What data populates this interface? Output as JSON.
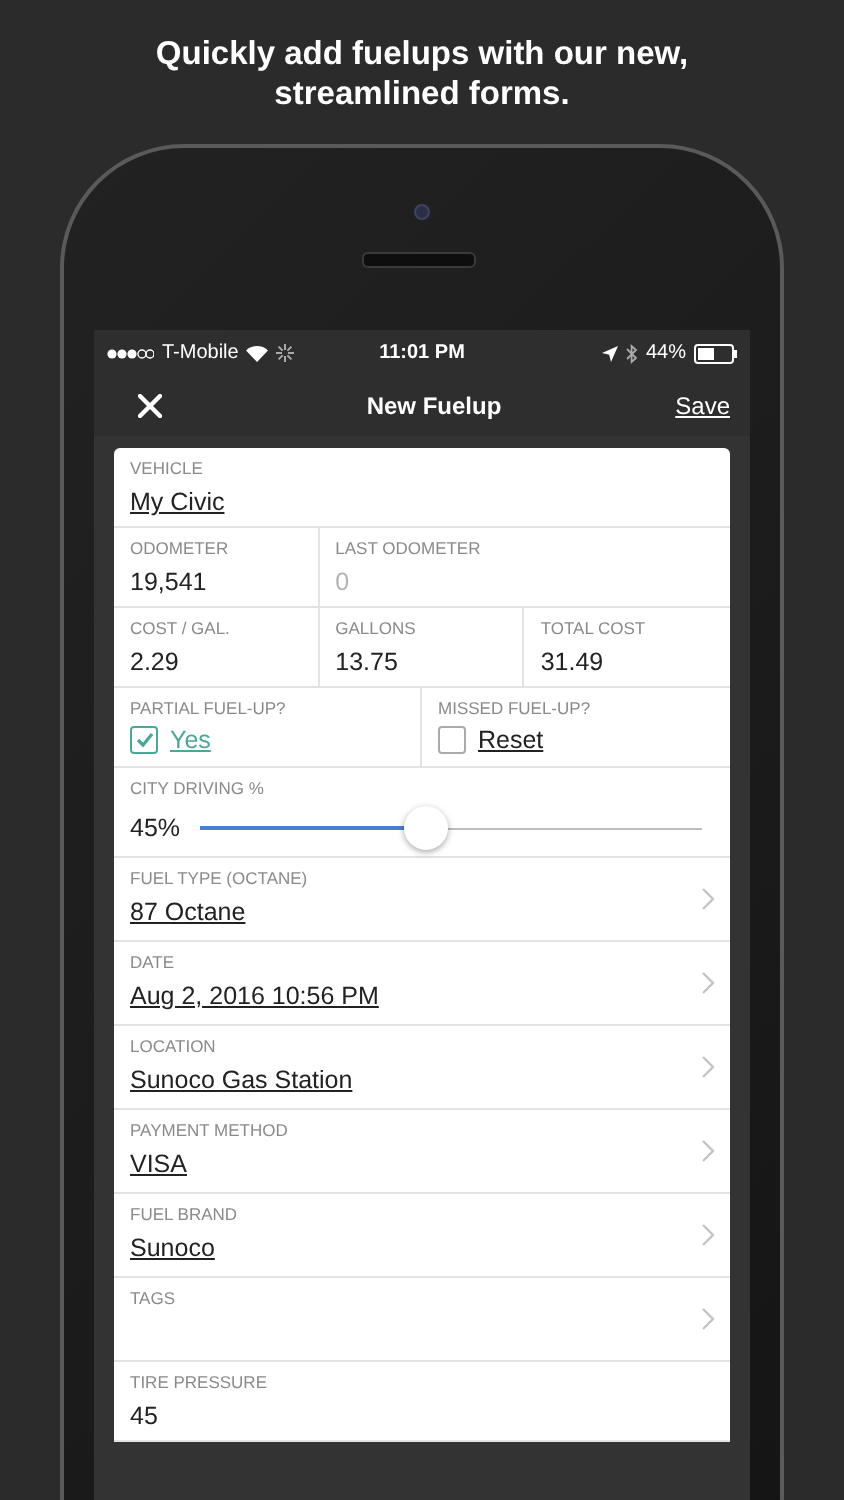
{
  "headline": "Quickly add fuelups with our new, streamlined forms.",
  "status_bar": {
    "carrier": "T-Mobile",
    "time": "11:01 PM",
    "battery": "44%"
  },
  "nav": {
    "title": "New Fuelup",
    "action": "Save"
  },
  "form": {
    "rows": [
      {
        "kind": "fields",
        "fields": [
          {
            "label": "VEHICLE",
            "value": "My Civic",
            "linked": true
          }
        ]
      },
      {
        "kind": "fields",
        "fields": [
          {
            "label": "ODOMETER",
            "value": "19,541",
            "linked": false
          },
          {
            "label": "LAST ODOMETER",
            "value": "0",
            "linked": false,
            "disabled": true
          }
        ]
      },
      {
        "kind": "fields",
        "fields": [
          {
            "label": "COST / GAL.",
            "value": "2.29",
            "linked": false
          },
          {
            "label": "GALLONS",
            "value": "13.75",
            "linked": false
          },
          {
            "label": "TOTAL COST",
            "value": "31.49",
            "linked": false
          }
        ]
      },
      {
        "kind": "checks",
        "items": [
          {
            "label": "PARTIAL FUEL-UP?",
            "text": "Yes",
            "checked": true
          },
          {
            "label": "MISSED FUEL-UP?",
            "text": "Reset",
            "checked": false
          }
        ]
      },
      {
        "kind": "slider",
        "label": "CITY DRIVING %",
        "reading": "45%",
        "level": 0.45
      },
      {
        "kind": "picker",
        "label": "FUEL TYPE (OCTANE)",
        "value": "87 Octane"
      },
      {
        "kind": "picker",
        "label": "DATE",
        "value": "Aug 2, 2016 10:56 PM"
      },
      {
        "kind": "picker",
        "label": "LOCATION",
        "value": "Sunoco Gas Station"
      },
      {
        "kind": "picker",
        "label": "PAYMENT METHOD",
        "value": "VISA"
      },
      {
        "kind": "picker",
        "label": "FUEL BRAND",
        "value": "Sunoco"
      },
      {
        "kind": "picker",
        "label": "TAGS"
      },
      {
        "kind": "fields",
        "fields": [
          {
            "label": "TIRE PRESSURE",
            "value": "45",
            "linked": false
          }
        ]
      }
    ]
  }
}
